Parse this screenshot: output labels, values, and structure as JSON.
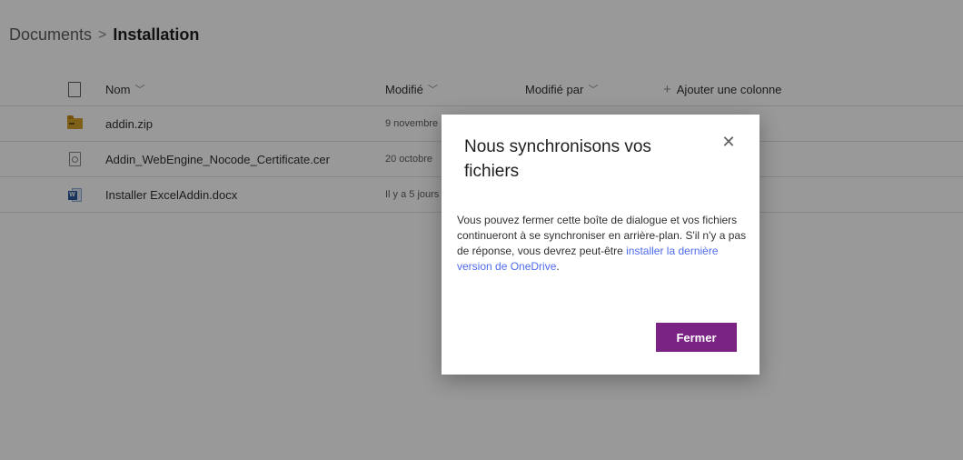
{
  "breadcrumb": {
    "root": "Documents",
    "separator": ">",
    "current": "Installation"
  },
  "table": {
    "headers": {
      "name": "Nom",
      "modified": "Modifié",
      "modified_by": "Modifié par",
      "add_column": "Ajouter une colonne"
    },
    "rows": [
      {
        "icon": "zip-folder-icon",
        "name": "addin.zip",
        "modified": "9 novembre"
      },
      {
        "icon": "certificate-file-icon",
        "name": "Addin_WebEngine_Nocode_Certificate.cer",
        "modified": "20 octobre"
      },
      {
        "icon": "word-document-icon",
        "name": "Installer ExcelAddin.docx",
        "modified": "Il y a 5 jours"
      }
    ]
  },
  "dialog": {
    "title": "Nous synchronisons vos fichiers",
    "body_text": "Vous pouvez fermer cette boîte de dialogue et vos fichiers continueront à se synchroniser en arrière-plan. S'il n'y a pas de réponse, vous devrez peut-être ",
    "link_text": "installer la dernière version de OneDrive",
    "body_end": ".",
    "close_label": "✕",
    "button_label": "Fermer"
  },
  "colors": {
    "accent": "#7b2285",
    "link": "#4f6bed",
    "overlay": "rgba(0,0,0,0.40)"
  }
}
